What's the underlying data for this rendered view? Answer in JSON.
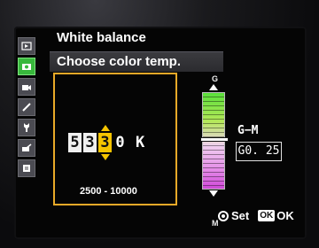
{
  "window": {
    "title": "White balance",
    "subtitle": "Choose color temp."
  },
  "sidebar": {
    "items": [
      {
        "icon": "playback-icon"
      },
      {
        "icon": "camera-icon",
        "active": true
      },
      {
        "icon": "movie-icon"
      },
      {
        "icon": "pencil-icon"
      },
      {
        "icon": "wrench-icon"
      },
      {
        "icon": "retouch-icon"
      },
      {
        "icon": "recent-settings-icon"
      }
    ]
  },
  "color_temp": {
    "digits": [
      "5",
      "3",
      "3",
      "0"
    ],
    "selected_index": 2,
    "unit": "K",
    "range": "2500 - 10000"
  },
  "tint": {
    "top_label": "G",
    "bottom_label": "M",
    "axis_label": "G−M",
    "value": "G0. 25"
  },
  "footer": {
    "set_label": "Set",
    "ok_badge": "OK",
    "ok_label": "OK"
  },
  "colors": {
    "accent": "#f5c400",
    "frame": "#e8a928",
    "active_tab": "#38b83c"
  }
}
